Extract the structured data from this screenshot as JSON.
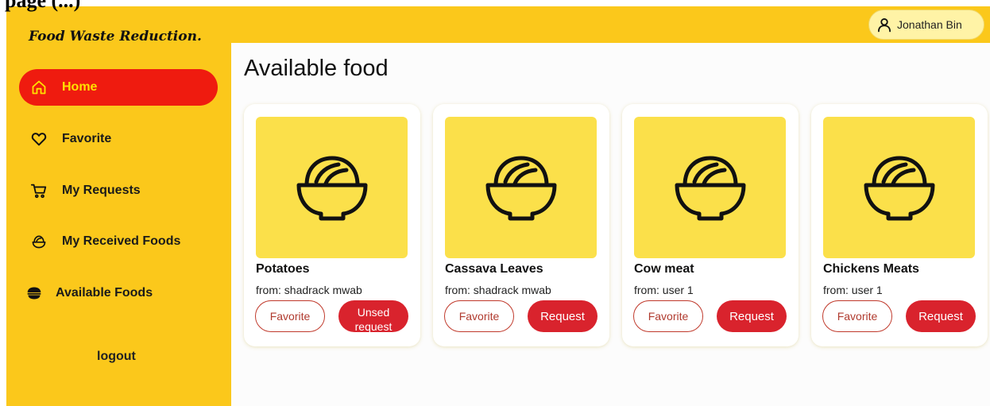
{
  "page_heading": "page (...)",
  "brand": "Food Waste Reduction.",
  "sidebar": {
    "items": [
      {
        "label": "Home",
        "icon": "home-icon",
        "active": true
      },
      {
        "label": "Favorite",
        "icon": "heart-icon",
        "active": false
      },
      {
        "label": "My Requests",
        "icon": "cart-icon",
        "active": false
      },
      {
        "label": "My Received Foods",
        "icon": "bowl-outline-icon",
        "active": false
      },
      {
        "label": "Available Foods",
        "icon": "bowl-filled-icon",
        "active": false
      }
    ],
    "logout": "logout"
  },
  "user": {
    "name": "Jonathan Bin",
    "icon": "user-icon"
  },
  "main": {
    "title": "Available food",
    "cards": [
      {
        "name": "Potatoes",
        "from": "from: shadrack mwab",
        "favorite": "Favorite",
        "request": "Unsed request",
        "icon": "food-bowl-icon"
      },
      {
        "name": "Cassava Leaves",
        "from": "from: shadrack mwab",
        "favorite": "Favorite",
        "request": "Request",
        "icon": "food-bowl-icon"
      },
      {
        "name": "Cow meat",
        "from": "from: user 1",
        "favorite": "Favorite",
        "request": "Request",
        "icon": "food-bowl-icon"
      },
      {
        "name": "Chickens Meats",
        "from": "from: user 1",
        "favorite": "Favorite",
        "request": "Request",
        "icon": "food-bowl-icon"
      }
    ]
  },
  "colors": {
    "primary_yellow": "#fbc81b",
    "active_red": "#ef1b0f",
    "button_red": "#d9232d",
    "thumb_yellow": "#fbe04a"
  }
}
